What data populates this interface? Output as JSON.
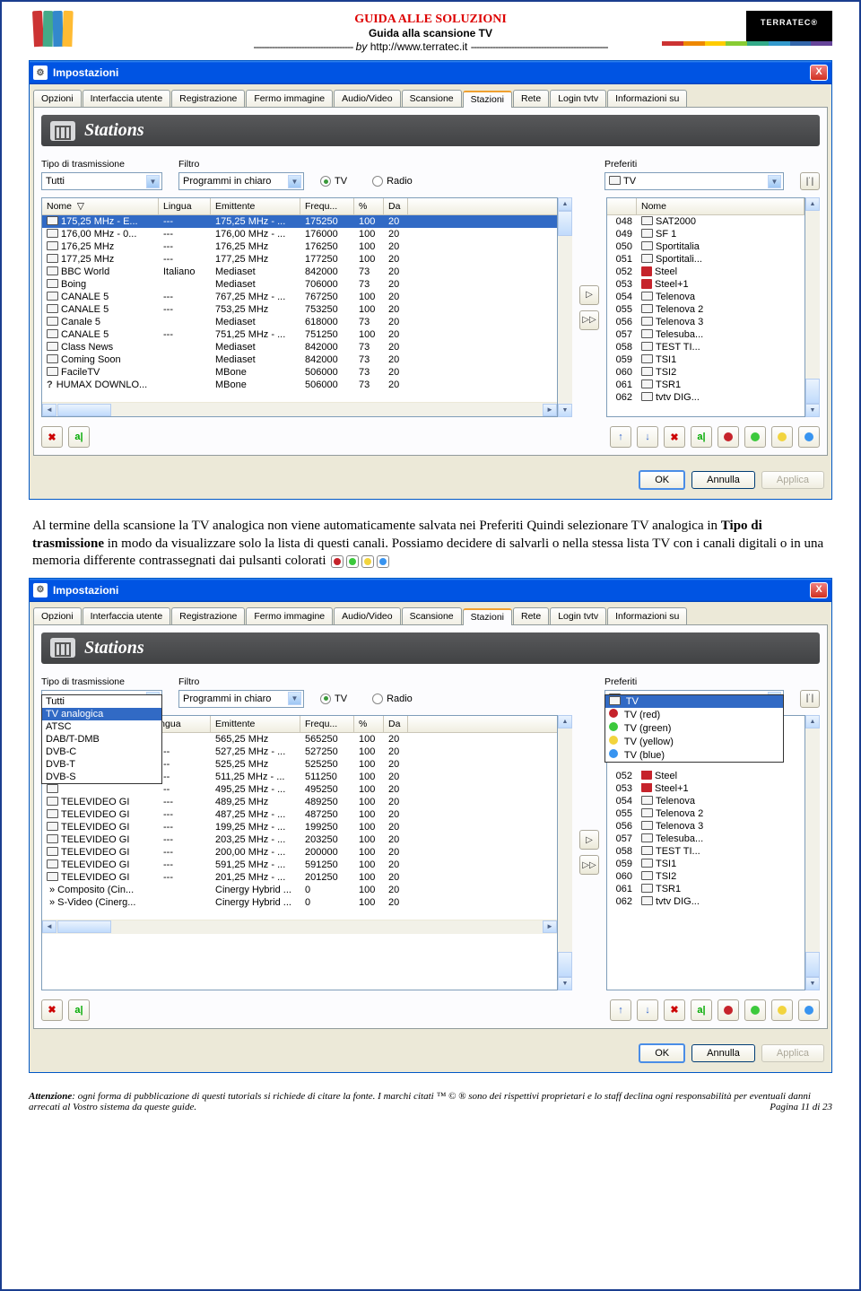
{
  "header": {
    "title_red": "GUIDA ALLE SOLUZIONI",
    "subtitle": "Guida alla scansione TV",
    "byline_dash_l": "-------------------------------------",
    "byline_by": "by",
    "byline_url": "http://www.terratec.it",
    "byline_dash_r": "---------------------------------------------------",
    "logo": "TERRATEC"
  },
  "win": {
    "title": "Impostazioni",
    "tabs": [
      "Opzioni",
      "Interfaccia utente",
      "Registrazione",
      "Fermo immagine",
      "Audio/Video",
      "Scansione",
      "Stazioni",
      "Rete",
      "Login tvtv",
      "Informazioni su"
    ],
    "stations_label": "Stations",
    "tipo_label": "Tipo di trasmissione",
    "filtro_label": "Filtro",
    "preferiti_label": "Preferiti",
    "tv_radio": "TV",
    "radio_radio": "Radio",
    "hdr_nome": "Nome",
    "hdr_lingua": "Lingua",
    "hdr_emit": "Emittente",
    "hdr_freq": "Frequ...",
    "hdr_pct": "%",
    "hdr_da": "Da",
    "ok": "OK",
    "annulla": "Annulla",
    "applica": "Applica"
  },
  "w1": {
    "tipo_val": "Tutti",
    "filtro_val": "Programmi in chiaro",
    "pref_val": "TV",
    "left": [
      {
        "n": "175,25 MHz - E...",
        "l": "---",
        "e": "175,25 MHz - ...",
        "f": "175250",
        "p": "100",
        "d": "20",
        "sel": true
      },
      {
        "n": "176,00 MHz - 0...",
        "l": "---",
        "e": "176,00 MHz - ...",
        "f": "176000",
        "p": "100",
        "d": "20"
      },
      {
        "n": "176,25 MHz",
        "l": "---",
        "e": "176,25 MHz",
        "f": "176250",
        "p": "100",
        "d": "20"
      },
      {
        "n": "177,25 MHz",
        "l": "---",
        "e": "177,25 MHz",
        "f": "177250",
        "p": "100",
        "d": "20"
      },
      {
        "n": "BBC World",
        "l": "Italiano",
        "e": "Mediaset",
        "f": "842000",
        "p": "73",
        "d": "20"
      },
      {
        "n": "Boing",
        "l": "",
        "e": "Mediaset",
        "f": "706000",
        "p": "73",
        "d": "20"
      },
      {
        "n": "CANALE 5",
        "l": "---",
        "e": "767,25 MHz - ...",
        "f": "767250",
        "p": "100",
        "d": "20"
      },
      {
        "n": "CANALE 5",
        "l": "---",
        "e": "753,25 MHz",
        "f": "753250",
        "p": "100",
        "d": "20"
      },
      {
        "n": "Canale 5",
        "l": "",
        "e": "Mediaset",
        "f": "618000",
        "p": "73",
        "d": "20"
      },
      {
        "n": "CANALE 5",
        "l": "---",
        "e": "751,25 MHz - ...",
        "f": "751250",
        "p": "100",
        "d": "20"
      },
      {
        "n": "Class News",
        "l": "",
        "e": "Mediaset",
        "f": "842000",
        "p": "73",
        "d": "20"
      },
      {
        "n": "Coming Soon",
        "l": "",
        "e": "Mediaset",
        "f": "842000",
        "p": "73",
        "d": "20"
      },
      {
        "n": "FacileTV",
        "l": "",
        "e": "MBone",
        "f": "506000",
        "p": "73",
        "d": "20"
      },
      {
        "n": "HUMAX DOWNLO...",
        "l": "",
        "e": "MBone",
        "f": "506000",
        "p": "73",
        "d": "20",
        "q": true
      }
    ],
    "right": [
      {
        "i": "048",
        "n": "SAT2000"
      },
      {
        "i": "049",
        "n": "SF 1"
      },
      {
        "i": "050",
        "n": "Sportitalia"
      },
      {
        "i": "051",
        "n": "Sportitali..."
      },
      {
        "i": "052",
        "n": "Steel",
        "c": "red"
      },
      {
        "i": "053",
        "n": "Steel+1",
        "c": "red"
      },
      {
        "i": "054",
        "n": "Telenova"
      },
      {
        "i": "055",
        "n": "Telenova 2"
      },
      {
        "i": "056",
        "n": "Telenova 3"
      },
      {
        "i": "057",
        "n": "Telesuba..."
      },
      {
        "i": "058",
        "n": "TEST TI..."
      },
      {
        "i": "059",
        "n": "TSI1"
      },
      {
        "i": "060",
        "n": "TSI2"
      },
      {
        "i": "061",
        "n": "TSR1"
      },
      {
        "i": "062",
        "n": "tvtv DIG..."
      }
    ]
  },
  "para": {
    "text": "Al termine della scansione la TV analogica non viene automaticamente salvata nei Preferiti Quindi selezionare TV analogica in ",
    "bold": "Tipo di trasmissione",
    "text2": " in modo da visualizzare solo la lista di questi canali. Possiamo decidere di salvarli o nella stessa lista TV con i canali digitali o in una memoria differente contrassegnati dai pulsanti colorati"
  },
  "w2": {
    "tipo_val": "TV analogica",
    "filtro_val": "Programmi in chiaro",
    "pref_val": "TV",
    "dd_opts": [
      "Tutti",
      "TV analogica",
      "ATSC",
      "DAB/T-DMB",
      "DVB-C",
      "DVB-T",
      "DVB-S"
    ],
    "left": [
      {
        "n": "",
        "l": "",
        "e": "565,25 MHz",
        "f": "565250",
        "p": "100",
        "d": "20"
      },
      {
        "n": "",
        "l": "--",
        "e": "527,25 MHz - ...",
        "f": "527250",
        "p": "100",
        "d": "20"
      },
      {
        "n": "",
        "l": "--",
        "e": "525,25 MHz",
        "f": "525250",
        "p": "100",
        "d": "20"
      },
      {
        "n": "",
        "l": "--",
        "e": "511,25 MHz - ...",
        "f": "511250",
        "p": "100",
        "d": "20"
      },
      {
        "n": "",
        "l": "--",
        "e": "495,25 MHz - ...",
        "f": "495250",
        "p": "100",
        "d": "20"
      },
      {
        "n": "TELEVIDEO GI",
        "l": "---",
        "e": "489,25 MHz",
        "f": "489250",
        "p": "100",
        "d": "20"
      },
      {
        "n": "TELEVIDEO GI",
        "l": "---",
        "e": "487,25 MHz - ...",
        "f": "487250",
        "p": "100",
        "d": "20"
      },
      {
        "n": "TELEVIDEO GI",
        "l": "---",
        "e": "199,25 MHz - ...",
        "f": "199250",
        "p": "100",
        "d": "20"
      },
      {
        "n": "TELEVIDEO GI",
        "l": "---",
        "e": "203,25 MHz - ...",
        "f": "203250",
        "p": "100",
        "d": "20"
      },
      {
        "n": "TELEVIDEO GI",
        "l": "---",
        "e": "200,00 MHz - ...",
        "f": "200000",
        "p": "100",
        "d": "20"
      },
      {
        "n": "TELEVIDEO GI",
        "l": "---",
        "e": "591,25 MHz - ...",
        "f": "591250",
        "p": "100",
        "d": "20"
      },
      {
        "n": "TELEVIDEO GI",
        "l": "---",
        "e": "201,25 MHz - ...",
        "f": "201250",
        "p": "100",
        "d": "20"
      },
      {
        "n": "» Composito (Cin...",
        "l": "",
        "e": "Cinergy Hybrid ...",
        "f": "0",
        "p": "100",
        "d": "20",
        "dot": "y"
      },
      {
        "n": "» S-Video (Cinerg...",
        "l": "",
        "e": "Cinergy Hybrid ...",
        "f": "0",
        "p": "100",
        "d": "20",
        "dot": "k"
      }
    ],
    "right_top": [
      {
        "n": "TV",
        "sel": true,
        "noicon": true
      },
      {
        "n": "TV (red)",
        "c": "red"
      },
      {
        "n": "TV (green)",
        "c": "grn"
      },
      {
        "n": "TV (yellow)",
        "c": "yel"
      },
      {
        "n": "TV (blue)",
        "c": "blu"
      }
    ],
    "right": [
      {
        "i": "052",
        "n": "Steel",
        "c": "red"
      },
      {
        "i": "053",
        "n": "Steel+1",
        "c": "red"
      },
      {
        "i": "054",
        "n": "Telenova"
      },
      {
        "i": "055",
        "n": "Telenova 2"
      },
      {
        "i": "056",
        "n": "Telenova 3"
      },
      {
        "i": "057",
        "n": "Telesuba..."
      },
      {
        "i": "058",
        "n": "TEST TI..."
      },
      {
        "i": "059",
        "n": "TSI1"
      },
      {
        "i": "060",
        "n": "TSI2"
      },
      {
        "i": "061",
        "n": "TSR1"
      },
      {
        "i": "062",
        "n": "tvtv DIG..."
      }
    ]
  },
  "footer": {
    "att": "Attenzione",
    "text1": ": ogni forma di pubblicazione di questi tutorials  si richiede di citare la fonte. I marchi citati ™ © ® sono dei rispettivi proprietari e  lo staff  declina ogni responsabilità per eventuali danni arrecati al Vostro sistema da queste guide.",
    "pagina": "Pagina 11 di 23"
  }
}
